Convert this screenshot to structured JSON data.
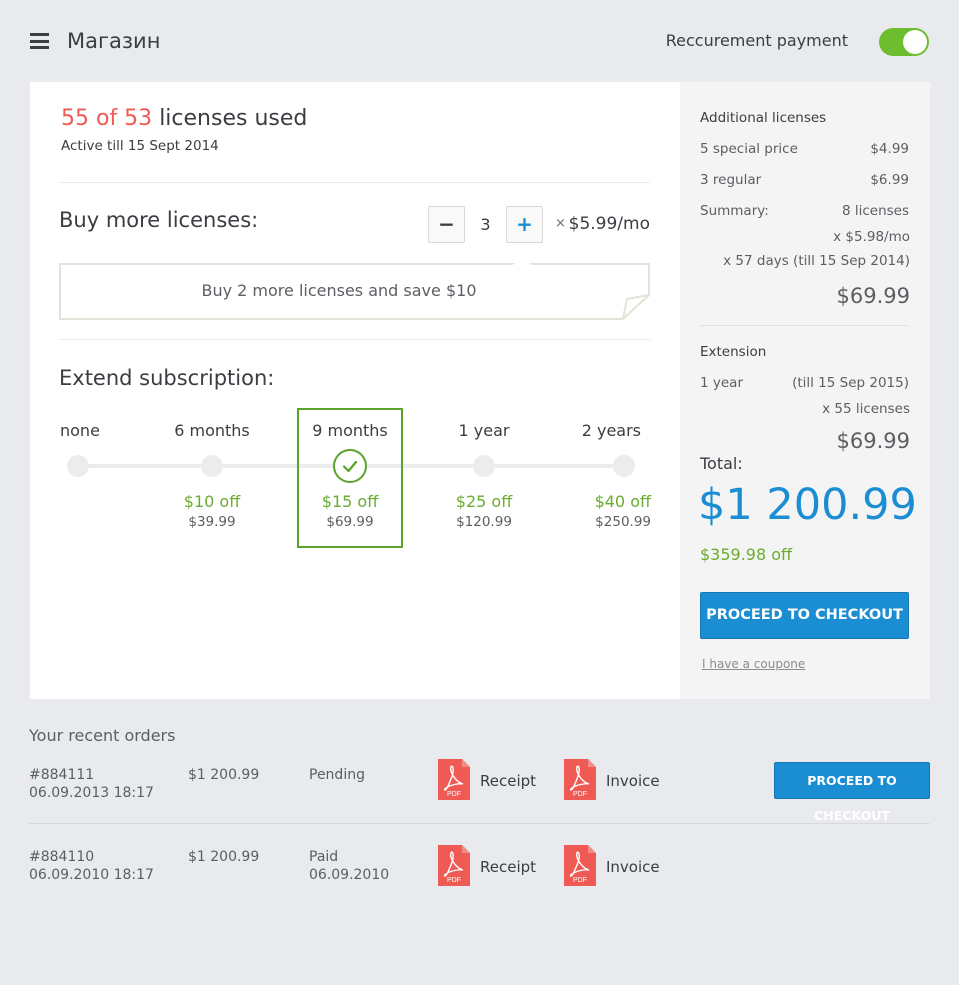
{
  "header": {
    "title": "Магазин",
    "recurring_label": "Reccurement payment",
    "recurring_on": true
  },
  "licenses": {
    "used": "55 of 53",
    "used_suffix": "licenses used",
    "active_till": "Active till 15 Sept 2014"
  },
  "buy": {
    "title": "Buy more licenses:",
    "minus": "−",
    "plus": "+",
    "quantity": "3",
    "times": "×",
    "price": "$5.99/mo",
    "promo": "Buy 2 more licenses and save $10"
  },
  "extend": {
    "title": "Extend subscription:",
    "options": [
      {
        "label": "none",
        "off": "",
        "price": ""
      },
      {
        "label": "6 months",
        "off": "$10 off",
        "price": "$39.99"
      },
      {
        "label": "9 months",
        "off": "$15 off",
        "price": "$69.99",
        "selected": true
      },
      {
        "label": "1 year",
        "off": "$25 off",
        "price": "$120.99"
      },
      {
        "label": "2 years",
        "off": "$40 off",
        "price": "$250.99"
      }
    ]
  },
  "summary": {
    "additional_title": "Additional licenses",
    "rows": [
      {
        "label": "5 special price",
        "value": "$4.99"
      },
      {
        "label": "3 regular",
        "value": "$6.99"
      },
      {
        "label": "Summary:",
        "value": "8 licenses"
      }
    ],
    "rate": "x $5.98/mo",
    "days": "x 57 days (till 15 Sep 2014)",
    "additional_total": "$69.99",
    "extension_title": "Extension",
    "ext_period": "1 year",
    "ext_till": "(till 15 Sep 2015)",
    "ext_licenses": "x 55 licenses",
    "ext_total": "$69.99",
    "total_label": "Total:",
    "total": "$1 200.99",
    "total_off": "$359.98 off",
    "checkout": "PROCEED TO CHECKOUT",
    "coupon": "I have a coupone"
  },
  "orders": {
    "title": "Your recent orders",
    "receipt_label": "Receipt",
    "invoice_label": "Invoice",
    "pdf_label": "PDF",
    "checkout": "PROCEED TO CHECKOUT",
    "items": [
      {
        "id": "#884111",
        "date": "06.09.2013 18:17",
        "amount": "$1 200.99",
        "status": "Pending",
        "status_date": ""
      },
      {
        "id": "#884110",
        "date": "06.09.2010 18:17",
        "amount": "$1 200.99",
        "status": "Paid",
        "status_date": "06.09.2010"
      }
    ]
  },
  "colors": {
    "accent": "#1b8ed3",
    "green": "#6aac2f",
    "red": "#ef5a55",
    "pdf_red": "#ef5a55"
  },
  "icons": [
    "hamburger-icon",
    "check-icon",
    "pdf-icon"
  ]
}
